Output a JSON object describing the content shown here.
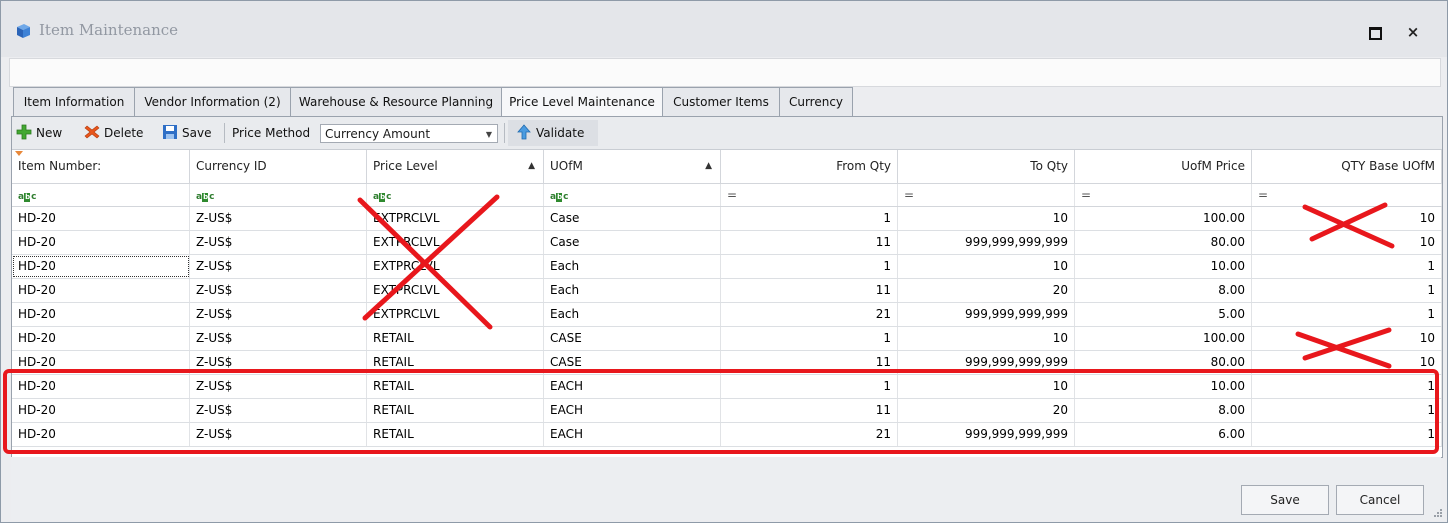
{
  "window": {
    "title": "Item Maintenance",
    "maximize_icon": "maximize-icon",
    "close_label": "×"
  },
  "tabs": [
    {
      "label": "Item Information",
      "active": false
    },
    {
      "label": "Vendor Information (2)",
      "active": false
    },
    {
      "label": "Warehouse & Resource Planning",
      "active": false
    },
    {
      "label": "Price Level Maintenance",
      "active": true
    },
    {
      "label": "Customer Items",
      "active": false
    },
    {
      "label": "Currency",
      "active": false
    }
  ],
  "toolbar": {
    "new_label": "New",
    "delete_label": "Delete",
    "save_label": "Save",
    "price_method_label": "Price Method",
    "price_method_value": "Currency Amount",
    "validate_label": "Validate"
  },
  "grid": {
    "columns": [
      "Item Number:",
      "Currency ID",
      "Price Level",
      "UOfM",
      "From Qty",
      "To Qty",
      "UofM Price",
      "QTY Base UOfM"
    ],
    "filter_icons": [
      "abc-filter-icon",
      "abc-filter-icon",
      "abc-filter-icon",
      "abc-filter-icon",
      "equals-filter-icon",
      "equals-filter-icon",
      "equals-filter-icon",
      "equals-filter-icon"
    ],
    "rows": [
      [
        "HD-20",
        "Z-US$",
        "EXTPRCLVL",
        "Case",
        "1",
        "10",
        "100.00",
        "10"
      ],
      [
        "HD-20",
        "Z-US$",
        "EXTPRCLVL",
        "Case",
        "11",
        "999,999,999,999",
        "80.00",
        "10"
      ],
      [
        "HD-20",
        "Z-US$",
        "EXTPRCLVL",
        "Each",
        "1",
        "10",
        "10.00",
        "1"
      ],
      [
        "HD-20",
        "Z-US$",
        "EXTPRCLVL",
        "Each",
        "11",
        "20",
        "8.00",
        "1"
      ],
      [
        "HD-20",
        "Z-US$",
        "EXTPRCLVL",
        "Each",
        "21",
        "999,999,999,999",
        "5.00",
        "1"
      ],
      [
        "HD-20",
        "Z-US$",
        "RETAIL",
        "CASE",
        "1",
        "10",
        "100.00",
        "10"
      ],
      [
        "HD-20",
        "Z-US$",
        "RETAIL",
        "CASE",
        "11",
        "999,999,999,999",
        "80.00",
        "10"
      ],
      [
        "HD-20",
        "Z-US$",
        "RETAIL",
        "EACH",
        "1",
        "10",
        "10.00",
        "1"
      ],
      [
        "HD-20",
        "Z-US$",
        "RETAIL",
        "EACH",
        "11",
        "20",
        "8.00",
        "1"
      ],
      [
        "HD-20",
        "Z-US$",
        "RETAIL",
        "EACH",
        "21",
        "999,999,999,999",
        "6.00",
        "1"
      ]
    ]
  },
  "footer": {
    "save_label": "Save",
    "cancel_label": "Cancel"
  },
  "colors": {
    "annotation_red": "#e8171c",
    "window_bg": "#ecedf0"
  }
}
